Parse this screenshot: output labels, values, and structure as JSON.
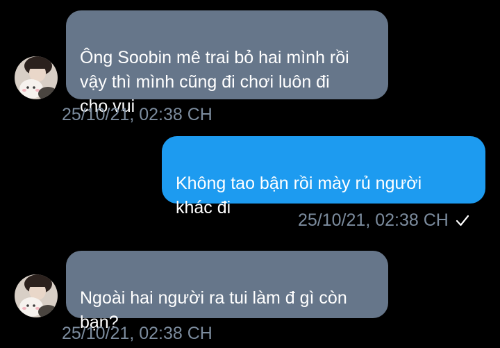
{
  "conversation": {
    "messages": [
      {
        "direction": "incoming",
        "text": "Ông Soobin mê trai bỏ hai mình rồi\nvậy thì mình cũng đi chơi luôn đi\ncho vui",
        "timestamp": "25/10/21, 02:38 CH",
        "avatar_icon": "user-avatar-icon"
      },
      {
        "direction": "outgoing",
        "text": "Không tao bận rồi mày rủ người\nkhác đi",
        "timestamp": "25/10/21, 02:38 CH",
        "status_icon": "checkmark-icon"
      },
      {
        "direction": "incoming",
        "text": "Ngoài hai người ra tui làm đ gì còn\nbạn?",
        "timestamp": "25/10/21, 02:38 CH",
        "avatar_icon": "user-avatar-icon"
      }
    ]
  },
  "colors": {
    "background": "#000000",
    "incoming_bubble": "#66768a",
    "outgoing_bubble": "#1d9bf0",
    "timestamp": "#7c8c9e",
    "text": "#ffffff"
  }
}
